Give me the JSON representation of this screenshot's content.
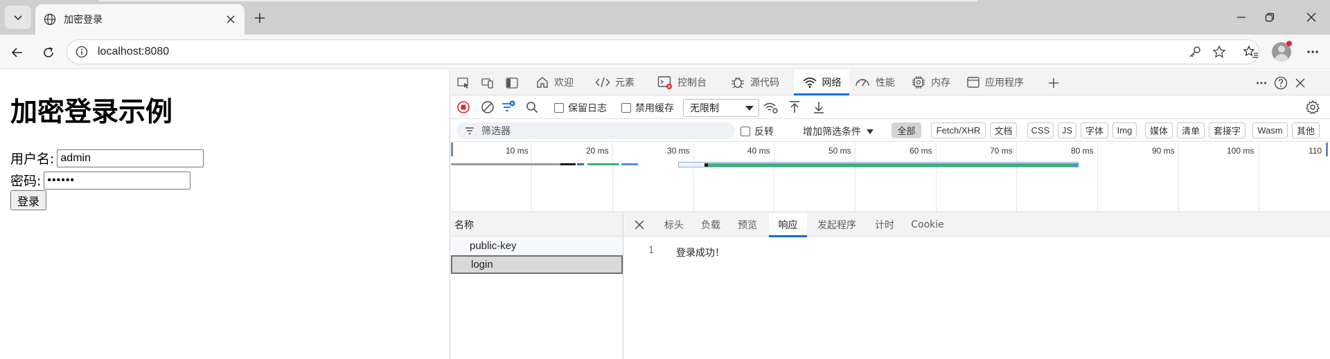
{
  "browser": {
    "tab_title": "加密登录",
    "url": "localhost:8080"
  },
  "page": {
    "heading": "加密登录示例",
    "username_label": "用户名:",
    "username_value": "admin",
    "password_label": "密码:",
    "password_value": "••••••",
    "login_button": "登录"
  },
  "devtools": {
    "tabs": [
      {
        "label": "欢迎",
        "icon": "home-icon"
      },
      {
        "label": "元素",
        "icon": "code-icon"
      },
      {
        "label": "控制台",
        "icon": "console-icon"
      },
      {
        "label": "源代码",
        "icon": "bug-icon"
      },
      {
        "label": "网络",
        "icon": "wifi-icon",
        "active": true
      },
      {
        "label": "性能",
        "icon": "gauge-icon"
      },
      {
        "label": "内存",
        "icon": "chip-icon"
      },
      {
        "label": "应用程序",
        "icon": "window-icon"
      }
    ],
    "toolbar": {
      "preserve_log": "保留日志",
      "disable_cache": "禁用缓存",
      "throttling": "无限制"
    },
    "filter": {
      "placeholder": "筛选器",
      "invert": "反转",
      "more_filters": "增加筛选条件",
      "types": [
        "全部",
        "Fetch/XHR",
        "文档",
        "CSS",
        "JS",
        "字体",
        "Img",
        "媒体",
        "清单",
        "套接字",
        "Wasm",
        "其他"
      ]
    },
    "timeline": {
      "ticks": [
        "10 ms",
        "20 ms",
        "30 ms",
        "40 ms",
        "50 ms",
        "60 ms",
        "70 ms",
        "80 ms",
        "90 ms",
        "100 ms",
        "110"
      ]
    },
    "requests": {
      "header": "名称",
      "rows": [
        "public-key",
        "login"
      ]
    },
    "detail": {
      "tabs": [
        "标头",
        "负载",
        "预览",
        "响应",
        "发起程序",
        "计时",
        "Cookie"
      ],
      "active_tab": "响应",
      "line_number": "1",
      "response_text": "登录成功！"
    },
    "colors": {
      "accent": "#0a6fd8",
      "record_red": "#e0262f",
      "bar_green": "#3cb371"
    }
  }
}
